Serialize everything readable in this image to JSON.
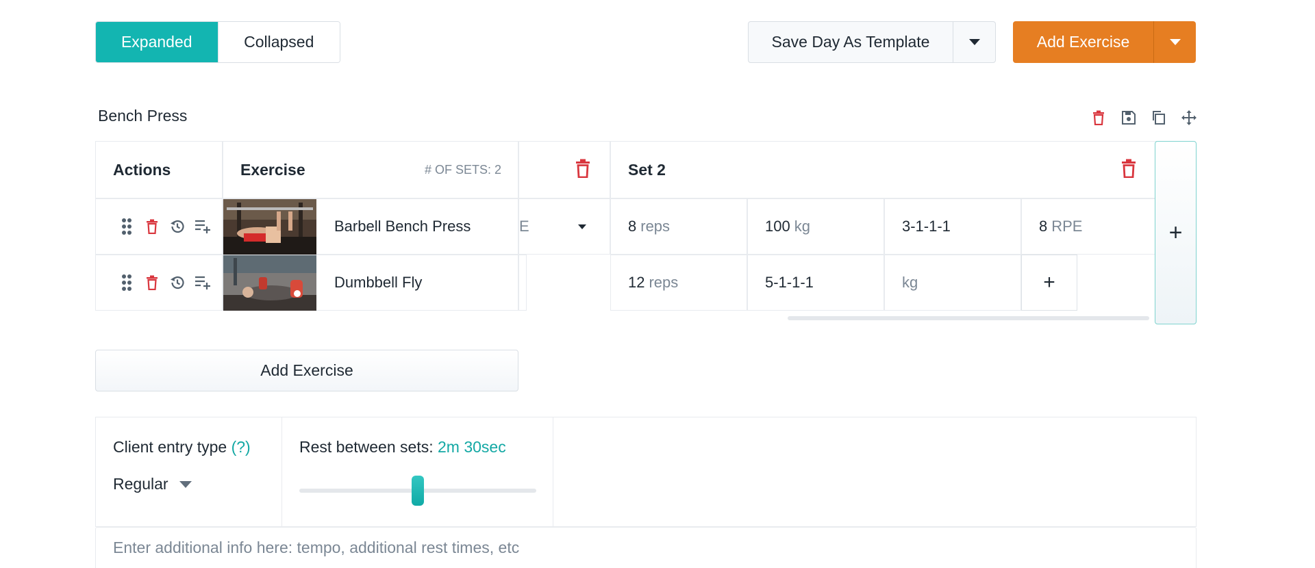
{
  "view_toggle": {
    "expanded": "Expanded",
    "collapsed": "Collapsed"
  },
  "toolbar": {
    "save_template": "Save Day As Template",
    "add_exercise": "Add Exercise"
  },
  "group": {
    "title": "Bench Press",
    "headers": {
      "actions": "Actions",
      "exercise": "Exercise",
      "sets_count": "# OF SETS: 2",
      "set2": "Set 2"
    },
    "rows": [
      {
        "name": "Barbell Bench Press",
        "partial": "E",
        "set2": [
          {
            "value": "8",
            "unit": "reps"
          },
          {
            "value": "100",
            "unit": "kg"
          },
          {
            "value": "3-1-1-1",
            "unit": ""
          },
          {
            "value": "8",
            "unit": "RPE"
          }
        ]
      },
      {
        "name": "Dumbbell Fly",
        "set2": [
          {
            "value": "12",
            "unit": "reps"
          },
          {
            "value": "5-1-1-1",
            "unit": ""
          },
          {
            "value": "",
            "unit": "kg"
          }
        ]
      }
    ]
  },
  "add_exercise_bottom": "Add Exercise",
  "settings": {
    "entry_type_label": "Client entry type",
    "entry_type_help": "(?)",
    "entry_type_value": "Regular",
    "rest_label": "Rest between sets:",
    "rest_value": "2m 30sec",
    "rest_level": 0.5
  },
  "notes": {
    "placeholder": "Enter additional info here: tempo, additional rest times, etc"
  },
  "colors": {
    "accent": "#13b5b1",
    "orange": "#e67e22",
    "danger": "#d9363e"
  },
  "icons": [
    "caret-down-icon",
    "trash-icon",
    "save-icon",
    "copy-icon",
    "move-icon",
    "drag-handle-icon",
    "history-icon",
    "playlist-add-icon",
    "plus-icon"
  ]
}
